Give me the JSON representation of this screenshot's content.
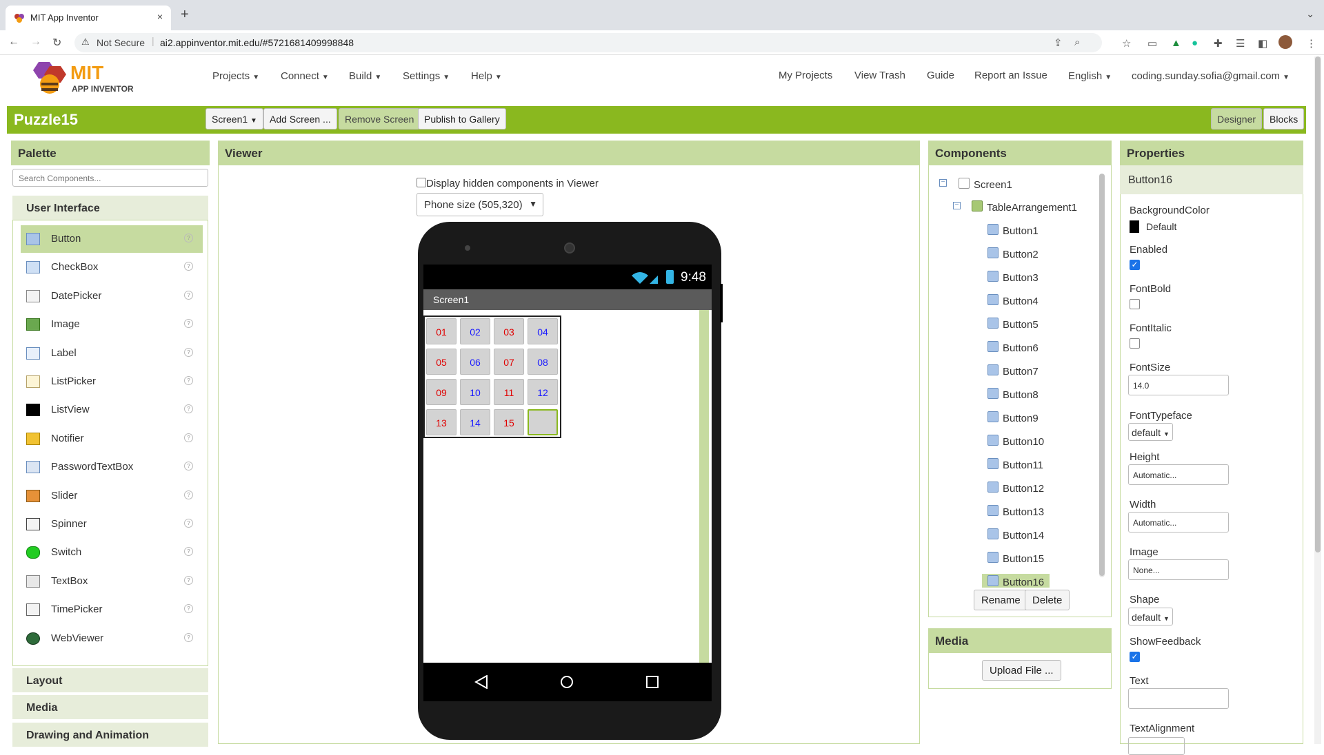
{
  "browser": {
    "tab_title": "MIT App Inventor",
    "tab_close": "×",
    "new_tab": "+",
    "security_label": "Not Secure",
    "url": "ai2.appinventor.mit.edu/#5721681409998848"
  },
  "app_header": {
    "logo_top": "MIT",
    "logo_bottom": "APP INVENTOR",
    "menus": [
      "Projects",
      "Connect",
      "Build",
      "Settings",
      "Help"
    ],
    "links": [
      "My Projects",
      "View Trash",
      "Guide",
      "Report an Issue"
    ],
    "language": "English",
    "account": "coding.sunday.sofia@gmail.com"
  },
  "project_bar": {
    "project_name": "Puzzle15",
    "screen_select": "Screen1",
    "add_screen": "Add Screen ...",
    "remove_screen": "Remove Screen",
    "publish": "Publish to Gallery",
    "designer": "Designer",
    "blocks": "Blocks"
  },
  "palette": {
    "title": "Palette",
    "search_placeholder": "Search Components...",
    "category": "User Interface",
    "items": [
      "Button",
      "CheckBox",
      "DatePicker",
      "Image",
      "Label",
      "ListPicker",
      "ListView",
      "Notifier",
      "PasswordTextBox",
      "Slider",
      "Spinner",
      "Switch",
      "TextBox",
      "TimePicker",
      "WebViewer"
    ],
    "help_glyph": "?",
    "other_categories": [
      "Layout",
      "Media",
      "Drawing and Animation"
    ]
  },
  "viewer": {
    "title": "Viewer",
    "hidden_checkbox_label": "Display hidden components in Viewer",
    "phone_size": "Phone size (505,320)",
    "status_time": "9:48",
    "screen_title": "Screen1",
    "buttons": [
      {
        "text": "01",
        "color": "red"
      },
      {
        "text": "02",
        "color": "blue"
      },
      {
        "text": "03",
        "color": "red"
      },
      {
        "text": "04",
        "color": "blue"
      },
      {
        "text": "05",
        "color": "red"
      },
      {
        "text": "06",
        "color": "blue"
      },
      {
        "text": "07",
        "color": "red"
      },
      {
        "text": "08",
        "color": "blue"
      },
      {
        "text": "09",
        "color": "red"
      },
      {
        "text": "10",
        "color": "blue"
      },
      {
        "text": "11",
        "color": "red"
      },
      {
        "text": "12",
        "color": "blue"
      },
      {
        "text": "13",
        "color": "red"
      },
      {
        "text": "14",
        "color": "blue"
      },
      {
        "text": "15",
        "color": "red"
      },
      {
        "text": "",
        "color": "empty"
      }
    ]
  },
  "components": {
    "title": "Components",
    "screen": "Screen1",
    "table": "TableArrangement1",
    "buttons": [
      "Button1",
      "Button2",
      "Button3",
      "Button4",
      "Button5",
      "Button6",
      "Button7",
      "Button8",
      "Button9",
      "Button10",
      "Button11",
      "Button12",
      "Button13",
      "Button14",
      "Button15",
      "Button16"
    ],
    "rename": "Rename",
    "delete": "Delete"
  },
  "media": {
    "title": "Media",
    "upload": "Upload File ..."
  },
  "properties": {
    "title": "Properties",
    "component": "Button16",
    "background_color_label": "BackgroundColor",
    "background_color_value": "Default",
    "enabled_label": "Enabled",
    "enabled": true,
    "fontbold_label": "FontBold",
    "fontbold": false,
    "fontitalic_label": "FontItalic",
    "fontitalic": false,
    "fontsize_label": "FontSize",
    "fontsize_value": "14.0",
    "fonttypeface_label": "FontTypeface",
    "fonttypeface_value": "default",
    "height_label": "Height",
    "height_value": "Automatic...",
    "width_label": "Width",
    "width_value": "Automatic...",
    "image_label": "Image",
    "image_value": "None...",
    "shape_label": "Shape",
    "shape_value": "default",
    "showfeedback_label": "ShowFeedback",
    "showfeedback": true,
    "text_label": "Text",
    "text_value": "",
    "textalignment_label": "TextAlignment"
  },
  "colors": {
    "accent_green": "#8ab81f",
    "panel_green": "#c6dba0",
    "red_text": "#e00000",
    "blue_text": "#1a1aff"
  }
}
